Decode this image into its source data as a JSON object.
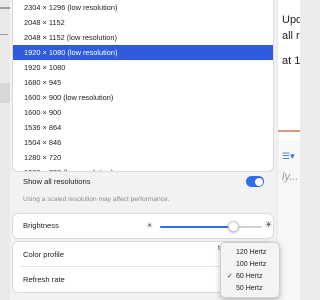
{
  "resolutions": {
    "items": [
      "2304 × 1296 (low resolution)",
      "2048 × 1152",
      "2048 × 1152 (low resolution)",
      "1920 × 1080 (low resolution)",
      "1920 × 1080",
      "1680 × 945",
      "1600 × 900 (low resolution)",
      "1600 × 900",
      "1536 × 864",
      "1504 × 846",
      "1280 × 720",
      "1280 × 720 (low resolution)",
      "1152 × 648"
    ],
    "selected_index": 3
  },
  "show_all": {
    "label": "Show all resolutions",
    "enabled": true
  },
  "scaled_note": "Using a scaled resolution may affect performance.",
  "brightness": {
    "label": "Brightness",
    "level": 0.72
  },
  "color_profile": {
    "label": "Color profile"
  },
  "refresh_rate": {
    "label": "Refresh rate",
    "options": [
      "120 Hertz",
      "100 Hertz",
      "60 Hertz",
      "50 Hertz"
    ],
    "selected_index": 2
  },
  "background_window": {
    "line1": "Upd",
    "line2": "all r",
    "line3": "at 1",
    "placeholder": "ly..."
  },
  "colors": {
    "accent": "#2f5bdc",
    "toggle": "#2f6df0"
  }
}
